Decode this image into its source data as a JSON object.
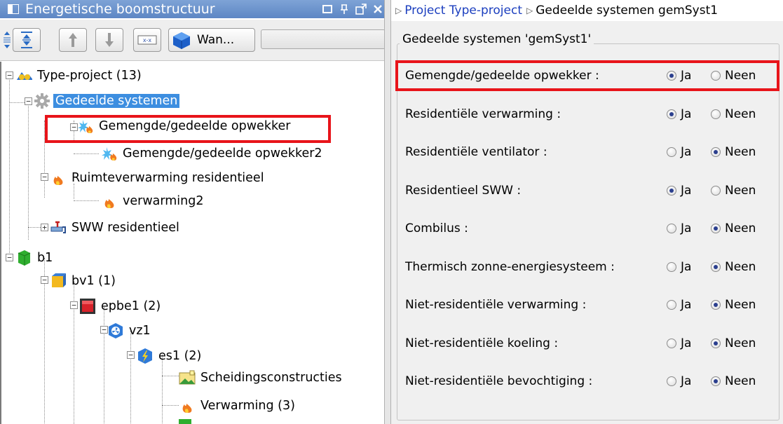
{
  "left_panel": {
    "title": "Energetische boomstructuur",
    "title_buttons": [
      "restore-icon",
      "pin-icon",
      "maximize-icon",
      "close-icon"
    ],
    "toolbar": {
      "filter_label": "Wan..."
    },
    "tree": [
      {
        "label": "Type-project (13)",
        "icon": "project-icon",
        "expander": "minus"
      },
      {
        "label": "Gedeelde systemen",
        "icon": "gear-icon",
        "expander": "minus",
        "selected": true
      },
      {
        "label": "Gemengde/gedeelde opwekker",
        "icon": "mixed-generator-icon",
        "expander": "minus"
      },
      {
        "label": "Gemengde/gedeelde opwekker2",
        "icon": "mixed-generator-icon"
      },
      {
        "label": "Ruimteverwarming residentieel",
        "icon": "flame-icon",
        "expander": "minus"
      },
      {
        "label": "verwarming2",
        "icon": "flame-icon"
      },
      {
        "label": "SWW residentieel",
        "icon": "tap-icon",
        "expander": "plus"
      },
      {
        "label": "b1",
        "icon": "building-icon",
        "expander": "minus"
      },
      {
        "label": "bv1 (1)",
        "icon": "unit-icon",
        "expander": "minus"
      },
      {
        "label": "epbe1 (2)",
        "icon": "epb-unit-icon",
        "expander": "minus"
      },
      {
        "label": "vz1",
        "icon": "ventilation-zone-icon",
        "expander": "minus"
      },
      {
        "label": "es1 (2)",
        "icon": "energy-sector-icon",
        "expander": "minus"
      },
      {
        "label": "Scheidingsconstructies",
        "icon": "construction-icon"
      },
      {
        "label": "Verwarming (3)",
        "icon": "flame-icon"
      }
    ]
  },
  "right_panel": {
    "breadcrumb": [
      {
        "label": "Project Type-project",
        "link": true
      },
      {
        "label": "Gedeelde systemen gemSyst1",
        "link": false
      }
    ],
    "group_title": "Gedeelde systemen 'gemSyst1'",
    "yes_label": "Ja",
    "no_label": "Neen",
    "rows": [
      {
        "label": "Gemengde/gedeelde opwekker :",
        "value": "Ja"
      },
      {
        "label": "Residentiële verwarming :",
        "value": "Ja"
      },
      {
        "label": "Residentiële ventilator :",
        "value": "Neen"
      },
      {
        "label": "Residentieel SWW :",
        "value": "Ja"
      },
      {
        "label": "Combilus :",
        "value": "Neen"
      },
      {
        "label": "Thermisch zonne-energiesysteem :",
        "value": "Neen"
      },
      {
        "label": "Niet-residentiële verwarming :",
        "value": "Neen"
      },
      {
        "label": "Niet-residentiële koeling :",
        "value": "Neen"
      },
      {
        "label": "Niet-residentiële bevochtiging :",
        "value": "Neen"
      }
    ]
  },
  "colors": {
    "highlight": "#e8141a",
    "selection": "#3d8ee0",
    "title_bar": "#6b92cc",
    "link": "#1c3fbf"
  }
}
